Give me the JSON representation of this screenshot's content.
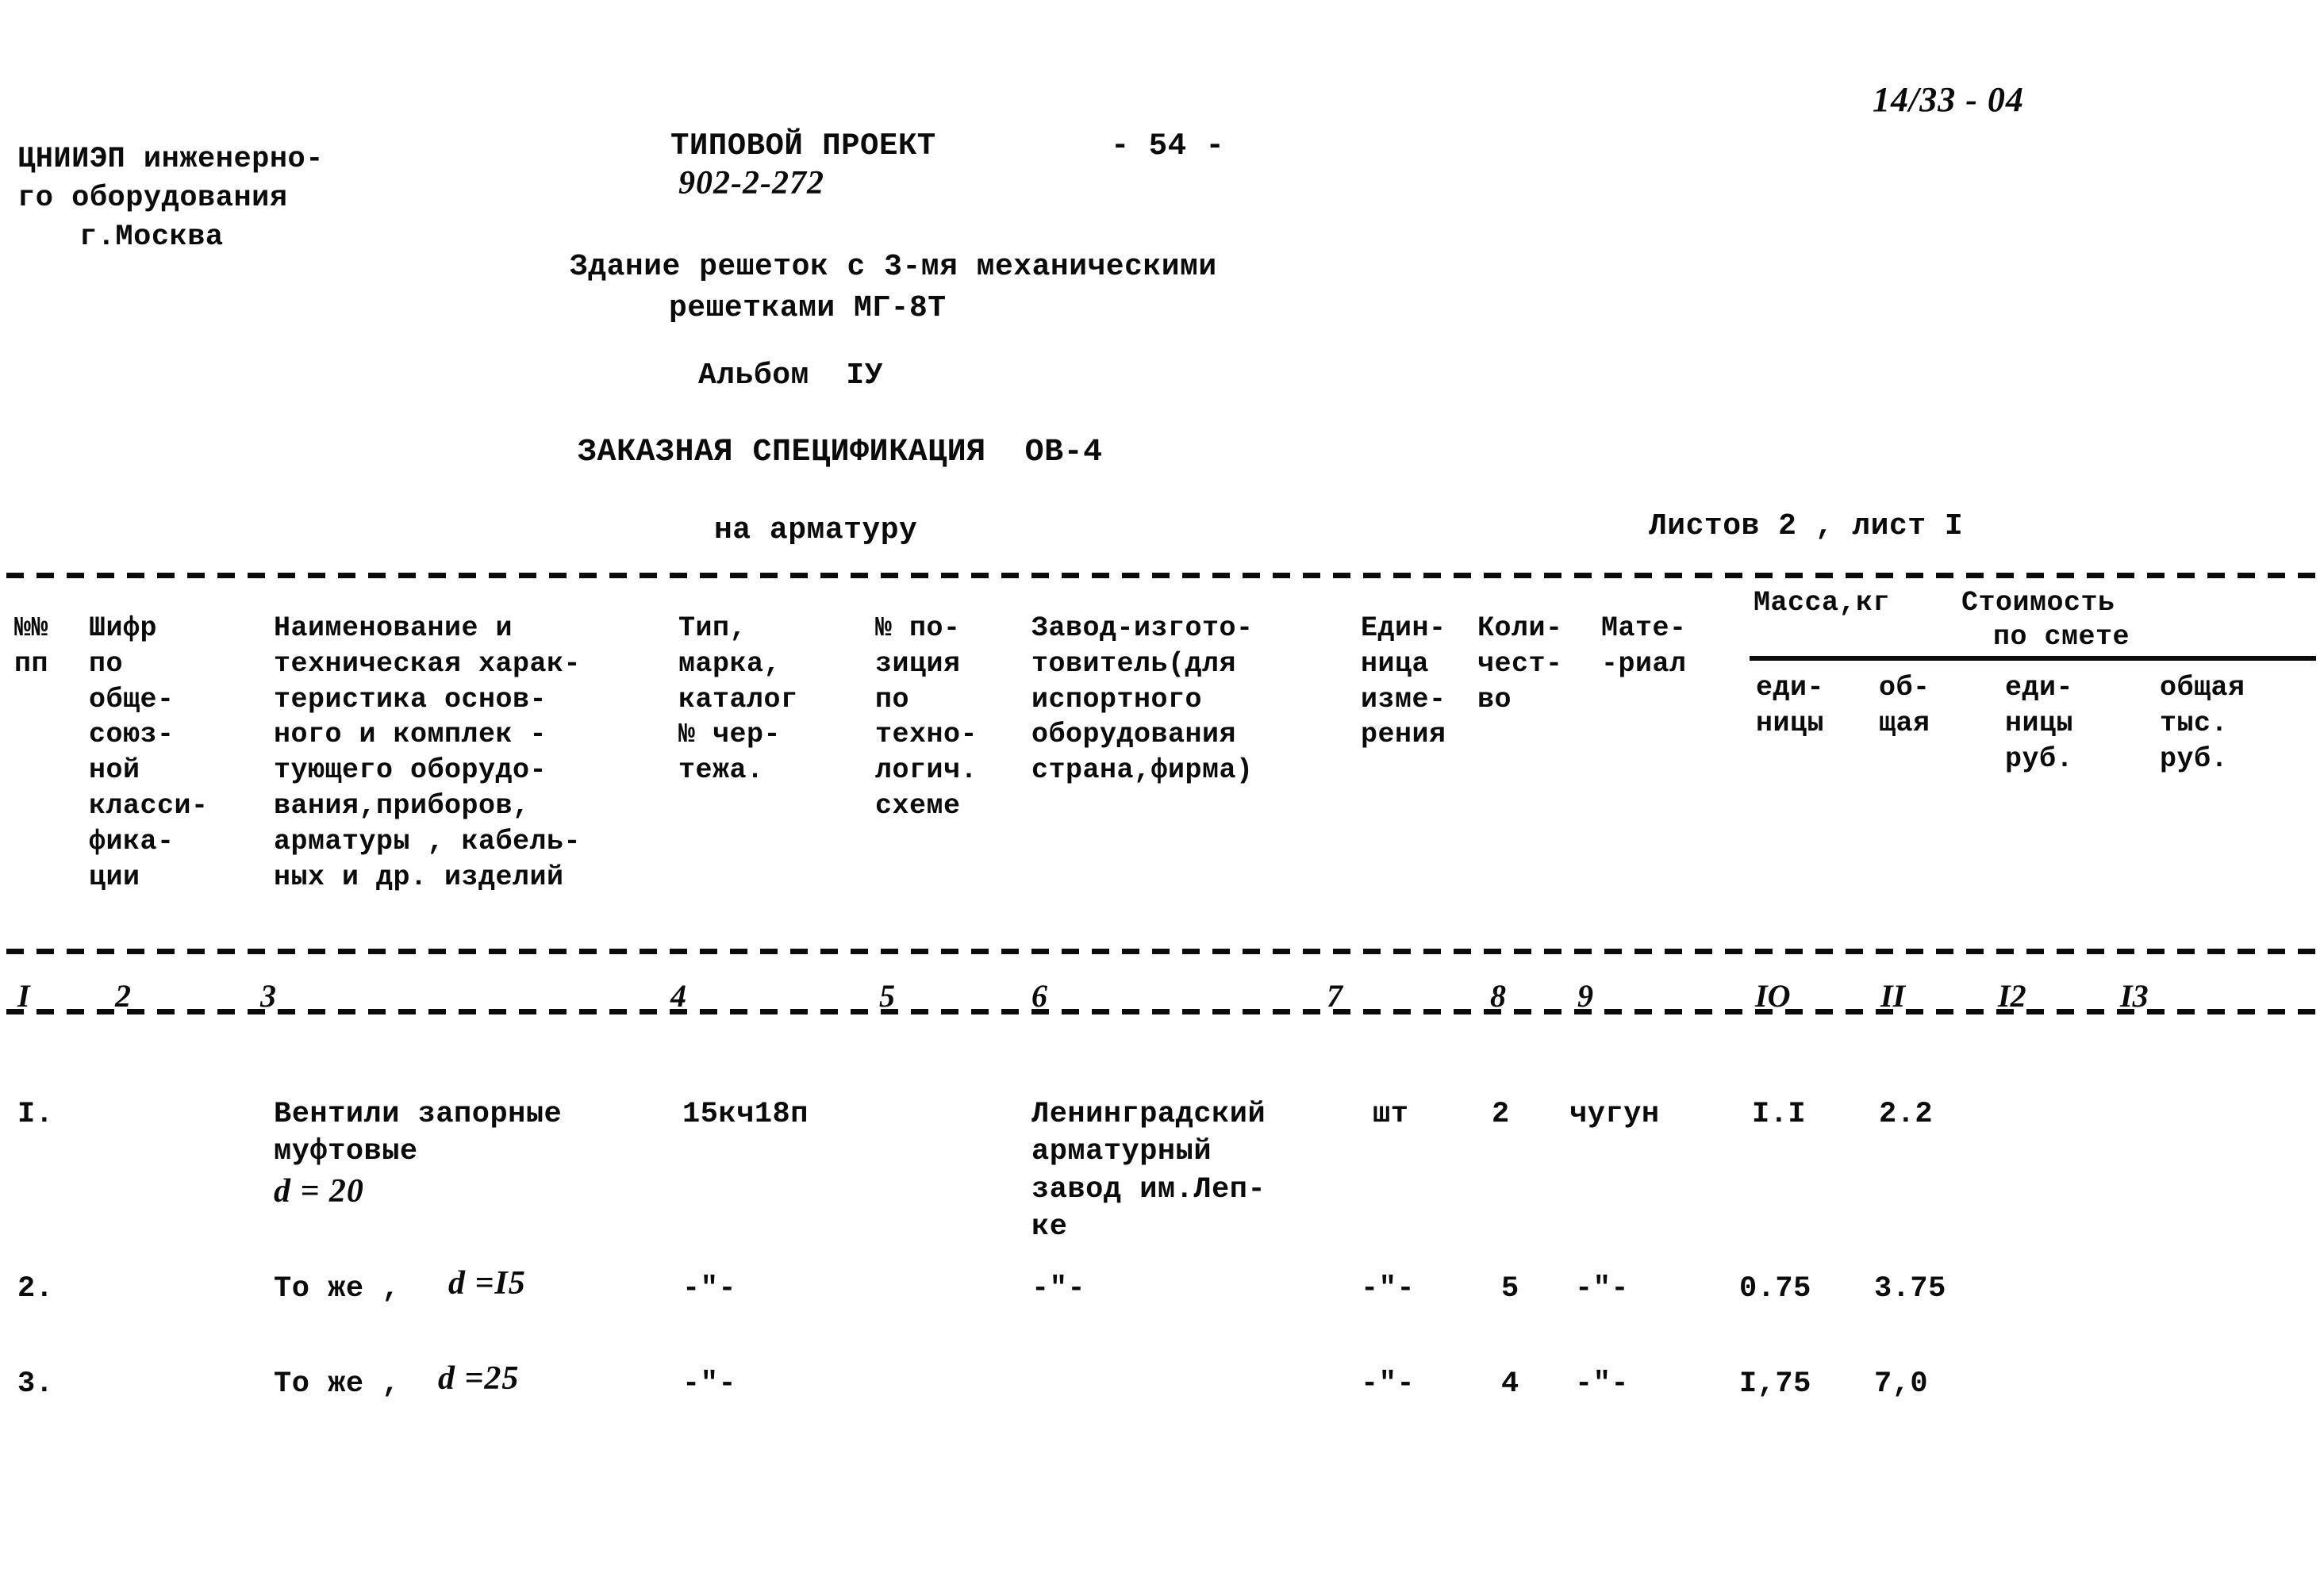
{
  "page": {
    "page_number": "- 54 -",
    "handwritten_code": "14/33 - 04",
    "sheet_info": "Листов 2 , лист I"
  },
  "org": {
    "line1": "ЦНИИЭП инженерно-",
    "line2": "го оборудования",
    "line3": "г.Москва"
  },
  "title": {
    "project_label": "ТИПОВОЙ ПРОЕКТ",
    "project_number": "902-2-272",
    "object_line1": "Здание решеток с 3-мя механическими",
    "object_line2": "решетками МГ-8Т",
    "album": "Альбом  IУ",
    "spec_title": "ЗАКАЗНАЯ СПЕЦИФИКАЦИЯ  ОВ-4",
    "spec_subject": "на арматуру"
  },
  "table": {
    "group_headers": {
      "mass": "Масса,кг",
      "cost_line1": "Стоимость",
      "cost_line2": "по смете"
    },
    "columns": [
      {
        "num": "I",
        "lines": [
          "№№",
          "пп"
        ]
      },
      {
        "num": "2",
        "lines": [
          "Шифр",
          "по",
          "обще-",
          "союз-",
          "ной",
          "класси-",
          "фика-",
          "ции"
        ]
      },
      {
        "num": "3",
        "lines": [
          "Наименование и",
          "техническая харак-",
          "теристика основ-",
          "ного и комплек -",
          "тующего оборудо-",
          "вания,приборов,",
          "арматуры , кабель-",
          "ных и др. изделий"
        ]
      },
      {
        "num": "4",
        "lines": [
          "Тип,",
          "марка,",
          "каталог",
          "№ чер-",
          "тежа."
        ]
      },
      {
        "num": "5",
        "lines": [
          "№ по-",
          "зиция",
          "по",
          "техно-",
          "логич.",
          "схеме"
        ]
      },
      {
        "num": "6",
        "lines": [
          "Завод-изгото-",
          "товитель(для",
          "испортного",
          "оборудования",
          "страна,фирма)"
        ]
      },
      {
        "num": "7",
        "lines": [
          "Един-",
          "ница",
          "изме-",
          "рения"
        ]
      },
      {
        "num": "8",
        "lines": [
          "Коли-",
          "чест-",
          "во"
        ]
      },
      {
        "num": "9",
        "lines": [
          "Мате-",
          "-риал"
        ]
      },
      {
        "num": "IO",
        "lines": [
          "еди-",
          "ницы"
        ]
      },
      {
        "num": "II",
        "lines": [
          "об-",
          "щая"
        ]
      },
      {
        "num": "I2",
        "lines": [
          "еди-",
          "ницы",
          "руб."
        ]
      },
      {
        "num": "I3",
        "lines": [
          "общая",
          "тыс.",
          "руб."
        ]
      }
    ],
    "rows": [
      {
        "no": "I.",
        "code": "",
        "name_lines": [
          "Вентили запорные",
          "муфтовые"
        ],
        "name_hand": "d = 20",
        "type": "15кч18п",
        "position": "",
        "manufacturer_lines": [
          "Ленинградский",
          "арматурный",
          "завод им.Леп-",
          "ке"
        ],
        "unit": "шт",
        "qty": "2",
        "material": "чугун",
        "mass_unit": "I.I",
        "mass_total": "2.2",
        "cost_unit": "",
        "cost_total": ""
      },
      {
        "no": "2.",
        "code": "",
        "name_lines": [
          "То же ,"
        ],
        "name_hand": "d =I5",
        "type": "-\"-",
        "position": "",
        "manufacturer_lines": [
          "-\"-"
        ],
        "unit": "-\"-",
        "qty": "5",
        "material": "-\"-",
        "mass_unit": "0.75",
        "mass_total": "3.75",
        "cost_unit": "",
        "cost_total": ""
      },
      {
        "no": "3.",
        "code": "",
        "name_lines": [
          "То же ,"
        ],
        "name_hand": "d =25",
        "type": "-\"-",
        "position": "",
        "manufacturer_lines": [
          ""
        ],
        "unit": "-\"-",
        "qty": "4",
        "material": "-\"-",
        "mass_unit": "I,75",
        "mass_total": "7,0",
        "cost_unit": "",
        "cost_total": ""
      }
    ]
  }
}
